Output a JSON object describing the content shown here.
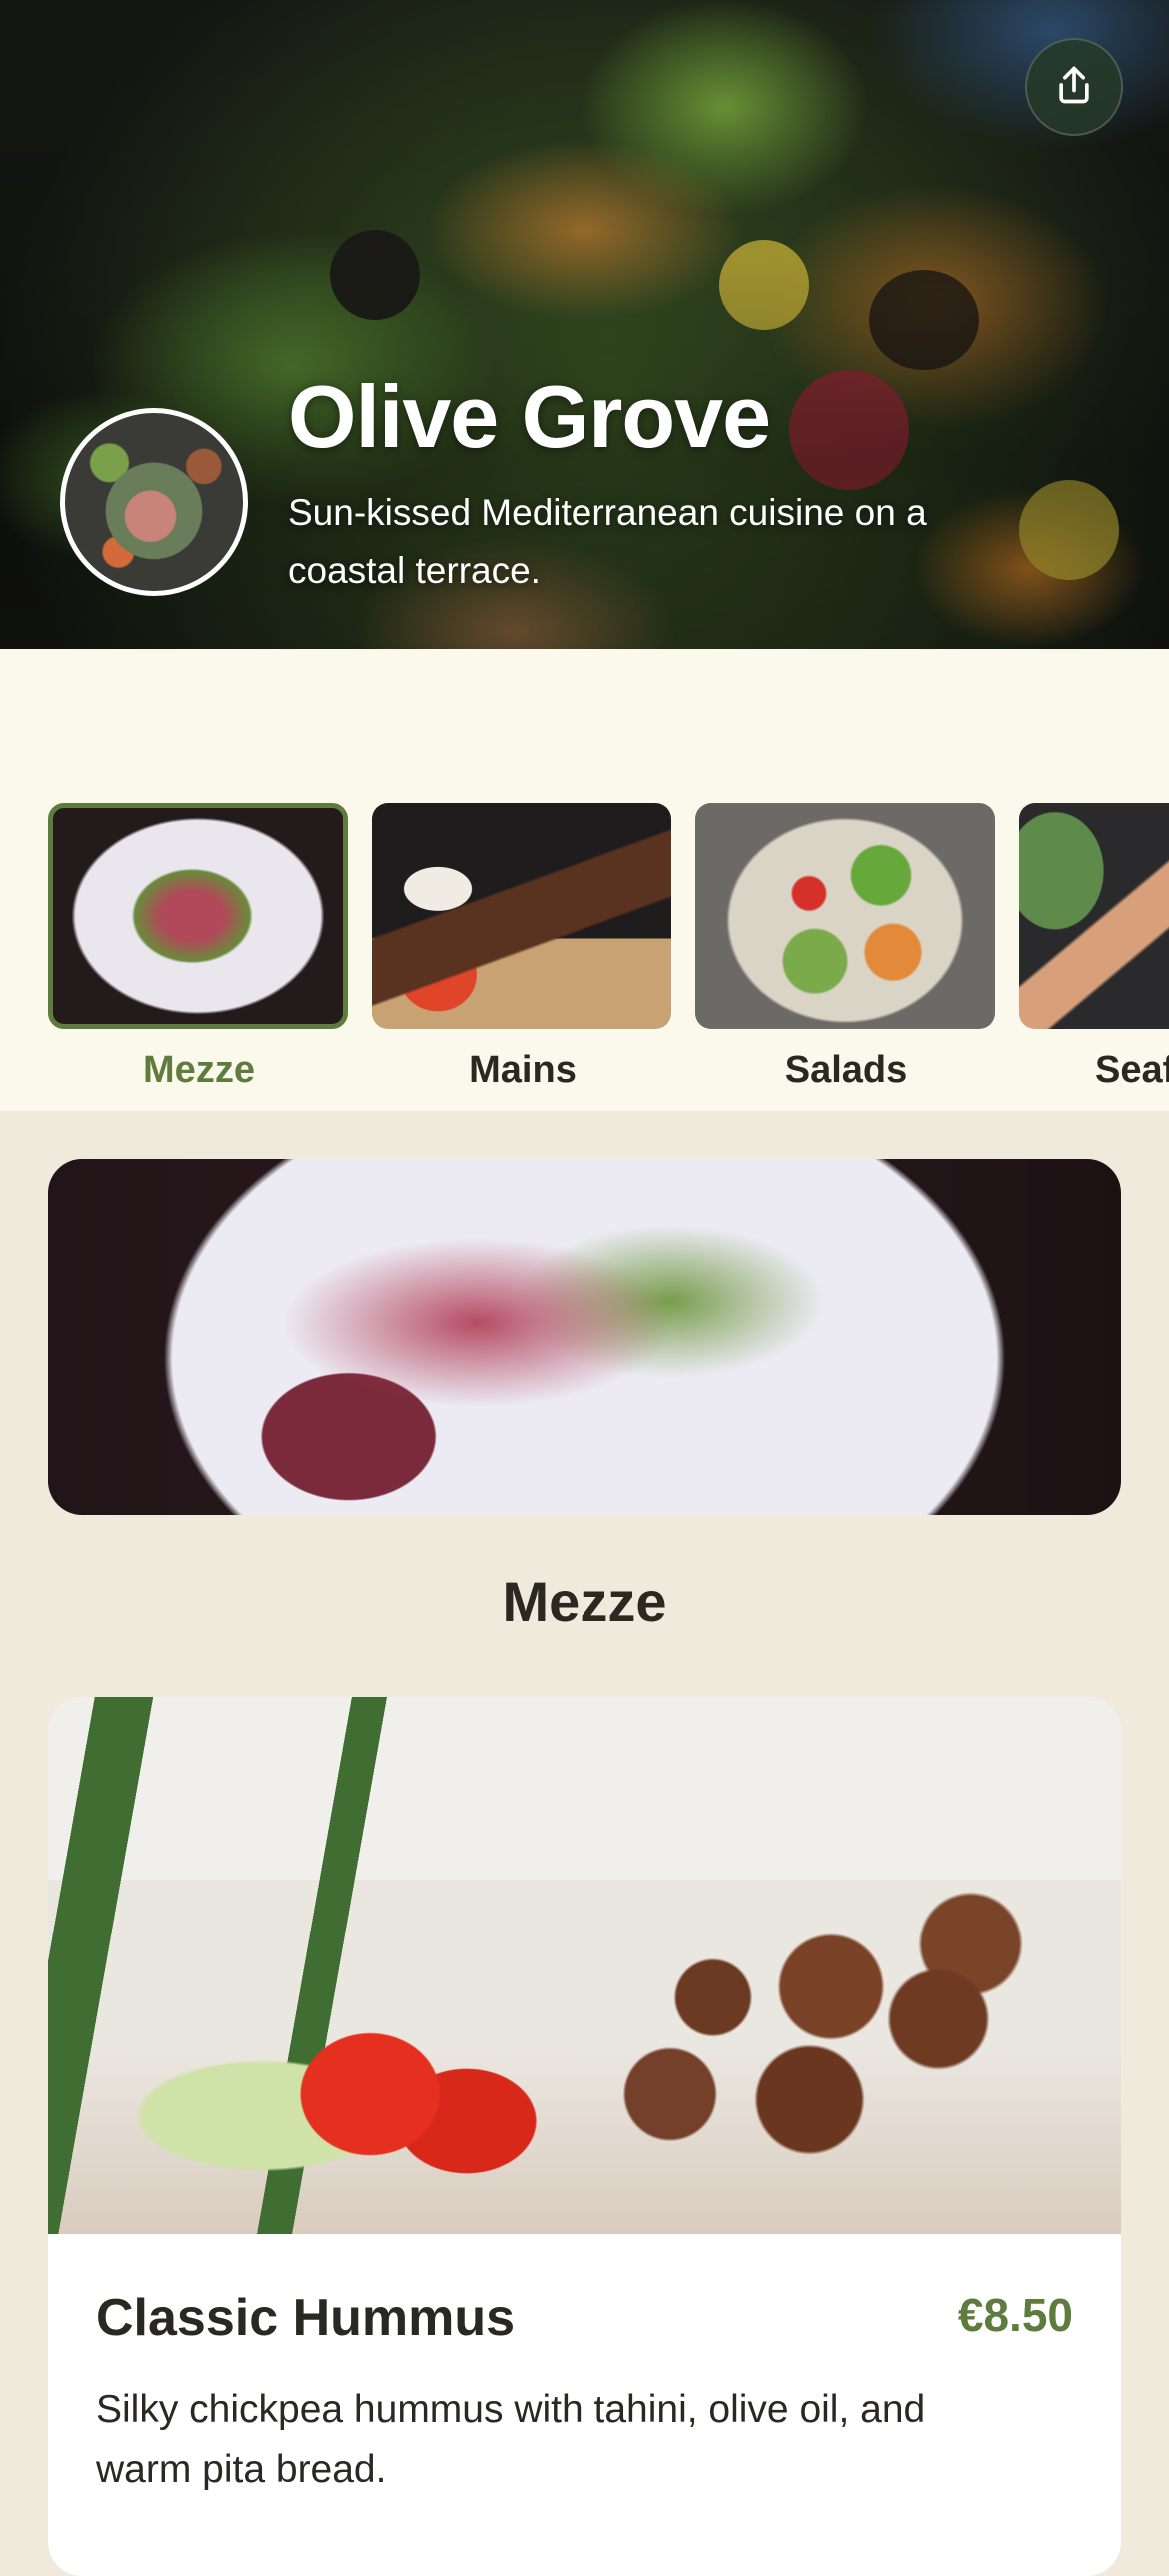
{
  "restaurant": {
    "name": "Olive Grove",
    "tagline": "Sun-kissed Mediterranean cuisine on a coastal terrace."
  },
  "icons": {
    "share": "share-icon",
    "logo": "restaurant-logo"
  },
  "colors": {
    "accent": "#5e7c3d",
    "text": "#2a2820",
    "page_background": "#efeadb",
    "strip_background": "#fbf9ec"
  },
  "categories": [
    {
      "label": "Mezze",
      "active": true
    },
    {
      "label": "Mains",
      "active": false
    },
    {
      "label": "Salads",
      "active": false
    },
    {
      "label": "Seafood",
      "active": false
    }
  ],
  "section": {
    "title": "Mezze"
  },
  "menu_items": [
    {
      "name": "Classic Hummus",
      "price": "€8.50",
      "description": "Silky chickpea hummus with tahini, olive oil, and warm pita bread."
    }
  ]
}
